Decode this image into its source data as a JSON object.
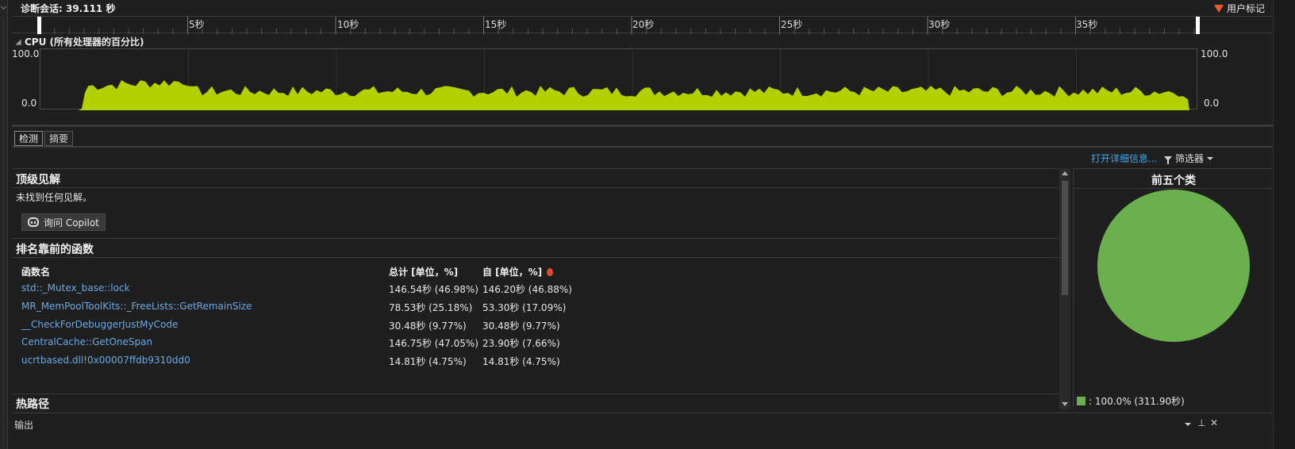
{
  "session": {
    "title": "诊断会话: 39.111 秒",
    "user_marks_label": "用户标记"
  },
  "ruler": {
    "labels": [
      "5秒",
      "10秒",
      "15秒",
      "20秒",
      "25秒",
      "30秒",
      "35秒"
    ]
  },
  "cpu": {
    "header": "CPU (所有处理器的百分比)",
    "y_max_label": "100.0",
    "y_min_label": "0.0"
  },
  "tabs": [
    {
      "label": "检测",
      "active": true
    },
    {
      "label": "摘要",
      "active": false
    }
  ],
  "toolbar": {
    "open_details": "打开详细信息...",
    "filter": "筛选器"
  },
  "insights": {
    "title": "顶级见解",
    "empty_message": "未找到任何见解。",
    "copilot_button": "询问 Copilot"
  },
  "functions": {
    "title": "排名靠前的函数",
    "columns": [
      "函数名",
      "总计 [单位，%]",
      "自 [单位，%]"
    ],
    "rows": [
      {
        "name": "std::_Mutex_base::lock",
        "total": "146.54秒 (46.98%)",
        "self": "146.20秒 (46.88%)"
      },
      {
        "name": "MR_MemPoolToolKits::_FreeLists::GetRemainSize",
        "total": "78.53秒 (25.18%)",
        "self": "53.30秒 (17.09%)"
      },
      {
        "name": "__CheckForDebuggerJustMyCode",
        "total": "30.48秒 (9.77%)",
        "self": "30.48秒 (9.77%)"
      },
      {
        "name": "CentralCache::GetOneSpan",
        "total": "146.75秒 (47.05%)",
        "self": "23.90秒 (7.66%)"
      },
      {
        "name": "ucrtbased.dll!0x00007ffdb9310dd0",
        "total": "14.81秒 (4.75%)",
        "self": "14.81秒 (4.75%)"
      }
    ]
  },
  "hot_path": {
    "title": "热路径"
  },
  "pie": {
    "title": "前五个类",
    "legend": ": 100.0% (311.90秒)",
    "color": "#6ab04c"
  },
  "output": {
    "title": "输出",
    "pin_glyph": "⊥",
    "close_glyph": "✕"
  },
  "colors": {
    "cpu_fill": "#b3d100",
    "link": "#6aa8e4",
    "accent": "#3fa8f4",
    "marker": "#ee5a24"
  }
}
